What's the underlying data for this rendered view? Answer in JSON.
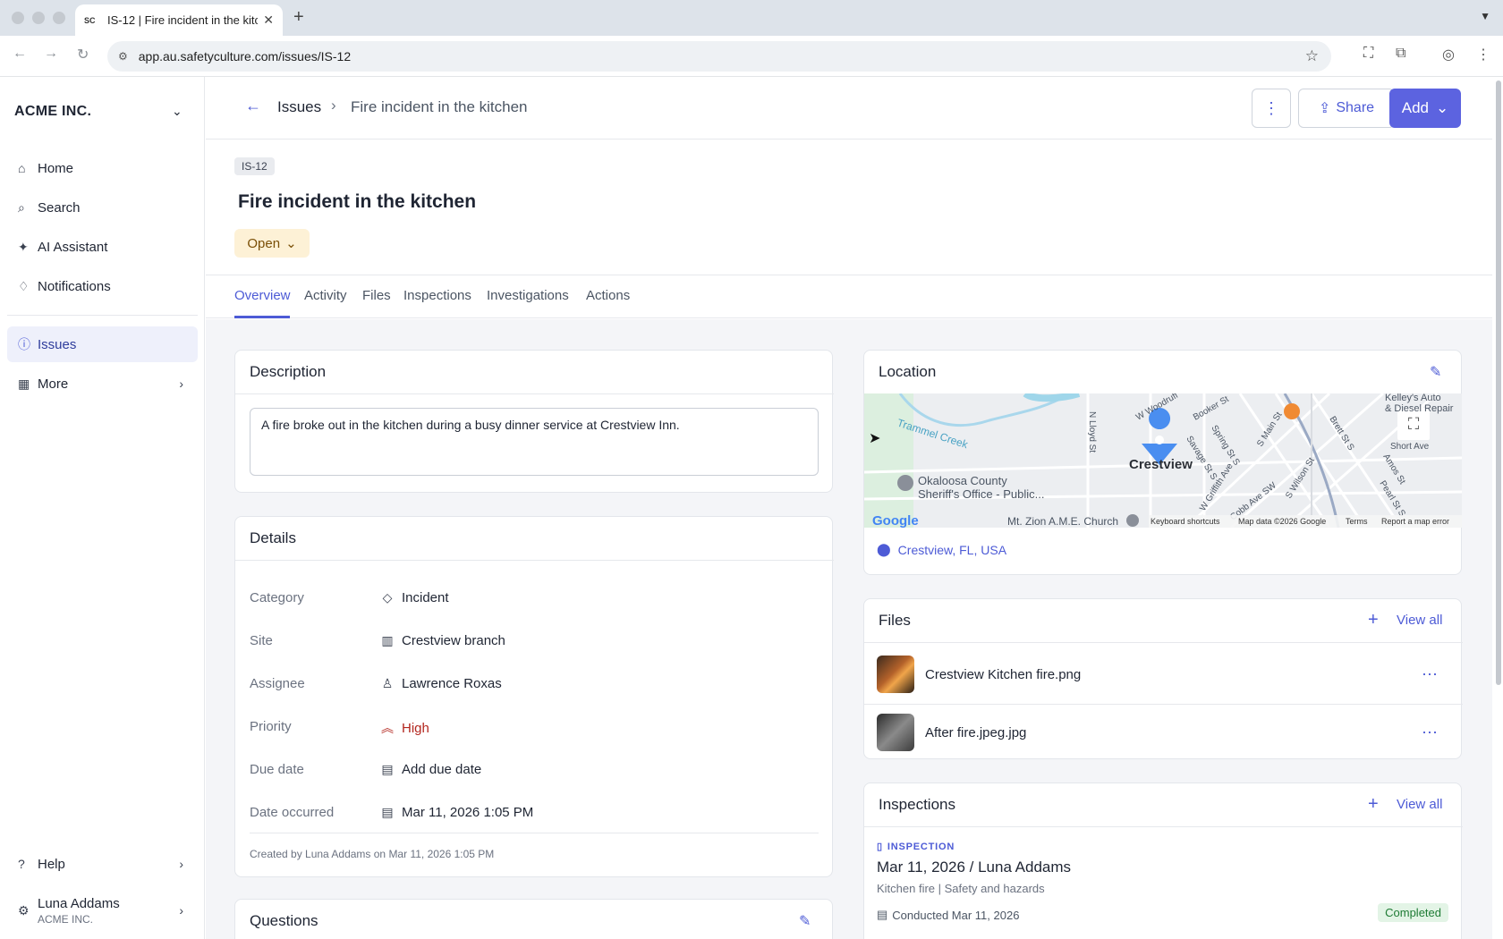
{
  "browser": {
    "tab_title": "IS-12 | Fire incident in the kitc",
    "favicon": "SC",
    "url": "app.au.safetyculture.com/issues/IS-12"
  },
  "sidebar": {
    "org": "ACME INC.",
    "items": [
      {
        "label": "Home",
        "icon": "home-icon"
      },
      {
        "label": "Search",
        "icon": "search-icon"
      },
      {
        "label": "AI Assistant",
        "icon": "sparkle-icon"
      },
      {
        "label": "Notifications",
        "icon": "bell-icon"
      },
      {
        "label": "Issues",
        "icon": "issue-icon"
      },
      {
        "label": "More",
        "icon": "grid-icon"
      }
    ],
    "help": "Help",
    "user_name": "Luna Addams",
    "user_org": "ACME INC."
  },
  "header": {
    "breadcrumb_root": "Issues",
    "breadcrumb_current": "Fire incident in the kitchen",
    "share_label": "Share",
    "add_label": "Add"
  },
  "issue": {
    "id": "IS-12",
    "title": "Fire incident in the kitchen",
    "status": "Open"
  },
  "tabs": [
    "Overview",
    "Activity",
    "Files",
    "Inspections",
    "Investigations",
    "Actions"
  ],
  "description": {
    "title": "Description",
    "text": "A fire broke out in the kitchen during a busy dinner service at Crestview Inn."
  },
  "details": {
    "title": "Details",
    "rows": [
      {
        "label": "Category",
        "value": "Incident"
      },
      {
        "label": "Site",
        "value": "Crestview branch"
      },
      {
        "label": "Assignee",
        "value": "Lawrence Roxas"
      },
      {
        "label": "Priority",
        "value": "High"
      },
      {
        "label": "Due date",
        "value": "Add due date"
      },
      {
        "label": "Date occurred",
        "value": "Mar 11, 2026 1:05 PM"
      }
    ],
    "created": "Created by Luna Addams on Mar 11, 2026 1:05 PM"
  },
  "questions": {
    "title": "Questions"
  },
  "location": {
    "title": "Location",
    "address": "Crestview, FL, USA",
    "map_labels": {
      "city": "Crestview",
      "creek": "Trammel Creek",
      "sheriff_1": "Okaloosa County",
      "sheriff_2": "Sheriff's Office - Public...",
      "church": "Mt. Zion A.M.E. Church",
      "street_lloyd": "N Lloyd St",
      "street_main": "S Main St",
      "street_wilson": "S Wilson St",
      "street_griffith": "W Griffith Ave",
      "street_cobb": "Cobb Ave SW",
      "street_spring": "Spring St S",
      "street_savage": "Savage St S",
      "street_booker": "Booker St",
      "street_brett": "Brett St S",
      "street_pearl": "Pearl St S",
      "street_amos": "Amos St",
      "street_short": "Short Ave",
      "street_woodruff": "W Woodruff",
      "kelley_1": "Kelley's Auto",
      "kelley_2": "& Diesel Repair",
      "google": "Google",
      "keyboard": "Keyboard shortcuts",
      "mapdata": "Map data ©2026 Google",
      "terms": "Terms",
      "report": "Report a map error"
    }
  },
  "files": {
    "title": "Files",
    "view_all": "View all",
    "items": [
      {
        "name": "Crestview Kitchen fire.png"
      },
      {
        "name": "After fire.jpeg.jpg"
      }
    ]
  },
  "inspections": {
    "title": "Inspections",
    "view_all": "View all",
    "tag": "INSPECTION",
    "item_title": "Mar 11, 2026 / Luna Addams",
    "item_sub": "Kitchen fire | Safety and hazards",
    "conducted": "Conducted Mar 11, 2026",
    "status": "Completed"
  },
  "colors": {
    "accent": "#5c63e0",
    "status_open_bg": "#fdf1d6",
    "priority_high": "#b3261e",
    "completed_bg": "#e3f4e6"
  }
}
